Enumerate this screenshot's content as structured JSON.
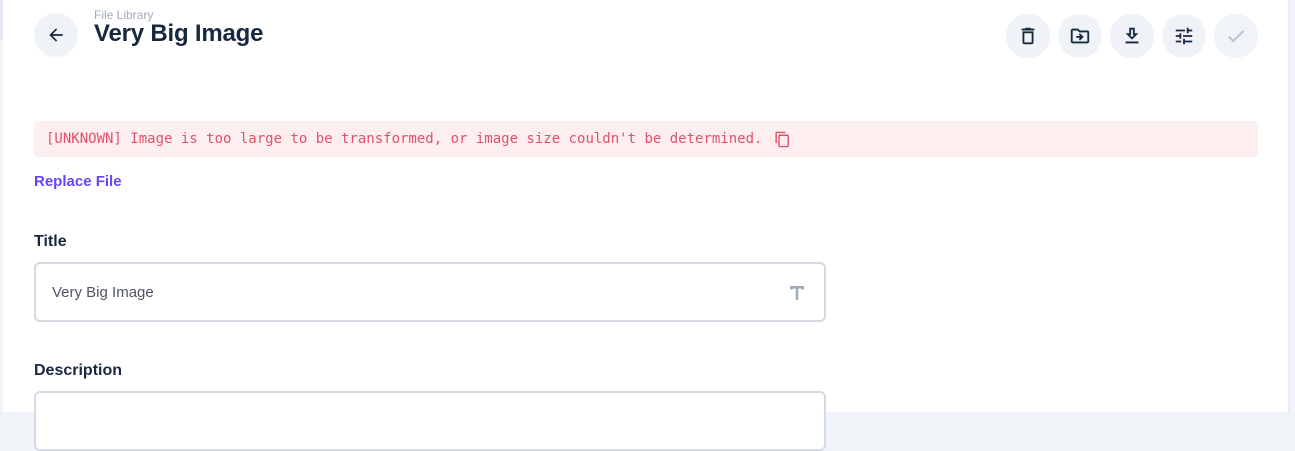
{
  "header": {
    "breadcrumb": "File Library",
    "title": "Very Big Image"
  },
  "actions": [
    {
      "name": "delete",
      "icon": "trash-icon"
    },
    {
      "name": "move",
      "icon": "folder-move-icon"
    },
    {
      "name": "download",
      "icon": "download-icon"
    },
    {
      "name": "settings",
      "icon": "sliders-icon"
    },
    {
      "name": "save",
      "icon": "check-icon",
      "disabled": true
    }
  ],
  "error": {
    "message": "[UNKNOWN] Image is too large to be transformed, or image size couldn't be determined."
  },
  "replace_file_label": "Replace File",
  "fields": {
    "title": {
      "label": "Title",
      "value": "Very Big Image"
    },
    "description": {
      "label": "Description",
      "value": ""
    }
  },
  "colors": {
    "accent": "#6644ff",
    "danger": "#e35169",
    "danger_bg": "#fdeef0",
    "title": "#172940"
  }
}
